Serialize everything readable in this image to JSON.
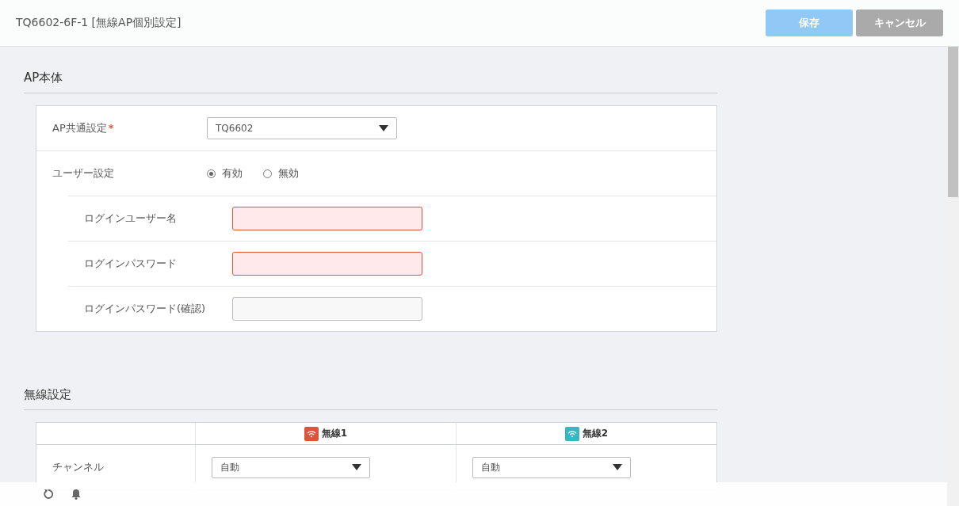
{
  "header": {
    "title": "TQ6602-6F-1 [無線AP個別設定]",
    "buttons": [
      {
        "label": "保存",
        "kind": "primary",
        "disabled": true
      },
      {
        "label": "キャンセル",
        "kind": "secondary",
        "disabled": false
      }
    ]
  },
  "sections": [
    {
      "title": "AP本体",
      "kind": "form",
      "rows": [
        {
          "kind": "select",
          "label": "AP共通設定",
          "required": "*",
          "value": "TQ6602"
        },
        {
          "kind": "radio",
          "label": "ユーザー設定",
          "options": [
            {
              "label": "有効",
              "selected": true
            },
            {
              "label": "無効",
              "selected": false
            }
          ],
          "children": [
            {
              "kind": "input",
              "label": "ログインユーザー名",
              "invalid": true
            },
            {
              "kind": "input",
              "label": "ログインパスワード",
              "invalid": true
            },
            {
              "kind": "input",
              "label": "ログインパスワード(確認)",
              "invalid": false
            }
          ]
        }
      ]
    },
    {
      "title": "無線設定",
      "kind": "table",
      "columns": [
        {
          "label": "無線1",
          "color": "#e0533b"
        },
        {
          "label": "無線2",
          "color": "#35b7c6"
        }
      ],
      "rows": [
        {
          "label": "チャンネル",
          "values": [
            "自動",
            "自動"
          ]
        }
      ]
    }
  ]
}
